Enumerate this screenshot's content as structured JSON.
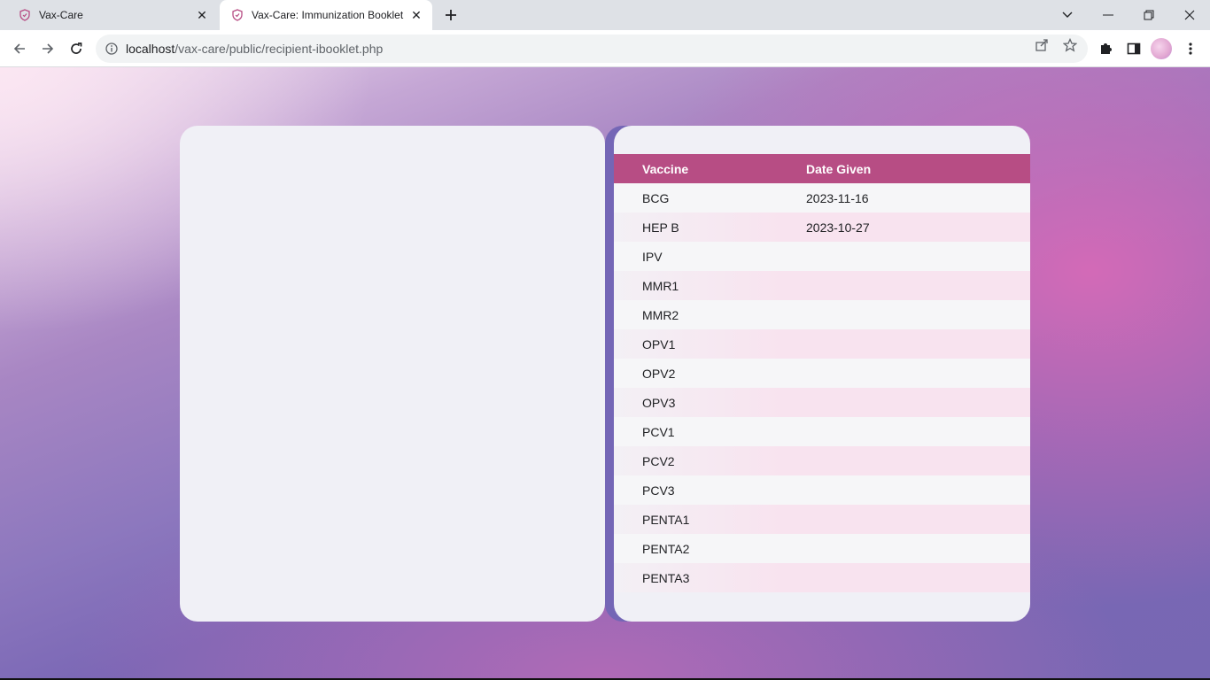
{
  "browser": {
    "tabs": [
      {
        "title": "Vax-Care",
        "active": false
      },
      {
        "title": "Vax-Care: Immunization Booklet",
        "active": true
      }
    ],
    "url_host": "localhost",
    "url_path": "/vax-care/public/recipient-ibooklet.php"
  },
  "table": {
    "headers": {
      "vaccine": "Vaccine",
      "date": "Date Given"
    },
    "rows": [
      {
        "vaccine": "BCG",
        "date": "2023-11-16"
      },
      {
        "vaccine": "HEP B",
        "date": "2023-10-27"
      },
      {
        "vaccine": "IPV",
        "date": ""
      },
      {
        "vaccine": "MMR1",
        "date": ""
      },
      {
        "vaccine": "MMR2",
        "date": ""
      },
      {
        "vaccine": "OPV1",
        "date": ""
      },
      {
        "vaccine": "OPV2",
        "date": ""
      },
      {
        "vaccine": "OPV3",
        "date": ""
      },
      {
        "vaccine": "PCV1",
        "date": ""
      },
      {
        "vaccine": "PCV2",
        "date": ""
      },
      {
        "vaccine": "PCV3",
        "date": ""
      },
      {
        "vaccine": "PENTA1",
        "date": ""
      },
      {
        "vaccine": "PENTA2",
        "date": ""
      },
      {
        "vaccine": "PENTA3",
        "date": ""
      }
    ]
  },
  "colors": {
    "header_bg": "#b74d84",
    "spine": "#7466b6",
    "page_bg": "#f0f0f6"
  }
}
